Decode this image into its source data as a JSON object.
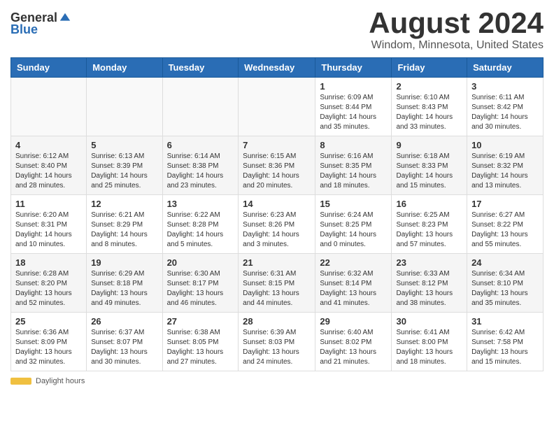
{
  "header": {
    "logo_general": "General",
    "logo_blue": "Blue",
    "title": "August 2024",
    "subtitle": "Windom, Minnesota, United States"
  },
  "days_of_week": [
    "Sunday",
    "Monday",
    "Tuesday",
    "Wednesday",
    "Thursday",
    "Friday",
    "Saturday"
  ],
  "weeks": [
    [
      {
        "day": "",
        "info": ""
      },
      {
        "day": "",
        "info": ""
      },
      {
        "day": "",
        "info": ""
      },
      {
        "day": "",
        "info": ""
      },
      {
        "day": "1",
        "info": "Sunrise: 6:09 AM\nSunset: 8:44 PM\nDaylight: 14 hours and 35 minutes."
      },
      {
        "day": "2",
        "info": "Sunrise: 6:10 AM\nSunset: 8:43 PM\nDaylight: 14 hours and 33 minutes."
      },
      {
        "day": "3",
        "info": "Sunrise: 6:11 AM\nSunset: 8:42 PM\nDaylight: 14 hours and 30 minutes."
      }
    ],
    [
      {
        "day": "4",
        "info": "Sunrise: 6:12 AM\nSunset: 8:40 PM\nDaylight: 14 hours and 28 minutes."
      },
      {
        "day": "5",
        "info": "Sunrise: 6:13 AM\nSunset: 8:39 PM\nDaylight: 14 hours and 25 minutes."
      },
      {
        "day": "6",
        "info": "Sunrise: 6:14 AM\nSunset: 8:38 PM\nDaylight: 14 hours and 23 minutes."
      },
      {
        "day": "7",
        "info": "Sunrise: 6:15 AM\nSunset: 8:36 PM\nDaylight: 14 hours and 20 minutes."
      },
      {
        "day": "8",
        "info": "Sunrise: 6:16 AM\nSunset: 8:35 PM\nDaylight: 14 hours and 18 minutes."
      },
      {
        "day": "9",
        "info": "Sunrise: 6:18 AM\nSunset: 8:33 PM\nDaylight: 14 hours and 15 minutes."
      },
      {
        "day": "10",
        "info": "Sunrise: 6:19 AM\nSunset: 8:32 PM\nDaylight: 14 hours and 13 minutes."
      }
    ],
    [
      {
        "day": "11",
        "info": "Sunrise: 6:20 AM\nSunset: 8:31 PM\nDaylight: 14 hours and 10 minutes."
      },
      {
        "day": "12",
        "info": "Sunrise: 6:21 AM\nSunset: 8:29 PM\nDaylight: 14 hours and 8 minutes."
      },
      {
        "day": "13",
        "info": "Sunrise: 6:22 AM\nSunset: 8:28 PM\nDaylight: 14 hours and 5 minutes."
      },
      {
        "day": "14",
        "info": "Sunrise: 6:23 AM\nSunset: 8:26 PM\nDaylight: 14 hours and 3 minutes."
      },
      {
        "day": "15",
        "info": "Sunrise: 6:24 AM\nSunset: 8:25 PM\nDaylight: 14 hours and 0 minutes."
      },
      {
        "day": "16",
        "info": "Sunrise: 6:25 AM\nSunset: 8:23 PM\nDaylight: 13 hours and 57 minutes."
      },
      {
        "day": "17",
        "info": "Sunrise: 6:27 AM\nSunset: 8:22 PM\nDaylight: 13 hours and 55 minutes."
      }
    ],
    [
      {
        "day": "18",
        "info": "Sunrise: 6:28 AM\nSunset: 8:20 PM\nDaylight: 13 hours and 52 minutes."
      },
      {
        "day": "19",
        "info": "Sunrise: 6:29 AM\nSunset: 8:18 PM\nDaylight: 13 hours and 49 minutes."
      },
      {
        "day": "20",
        "info": "Sunrise: 6:30 AM\nSunset: 8:17 PM\nDaylight: 13 hours and 46 minutes."
      },
      {
        "day": "21",
        "info": "Sunrise: 6:31 AM\nSunset: 8:15 PM\nDaylight: 13 hours and 44 minutes."
      },
      {
        "day": "22",
        "info": "Sunrise: 6:32 AM\nSunset: 8:14 PM\nDaylight: 13 hours and 41 minutes."
      },
      {
        "day": "23",
        "info": "Sunrise: 6:33 AM\nSunset: 8:12 PM\nDaylight: 13 hours and 38 minutes."
      },
      {
        "day": "24",
        "info": "Sunrise: 6:34 AM\nSunset: 8:10 PM\nDaylight: 13 hours and 35 minutes."
      }
    ],
    [
      {
        "day": "25",
        "info": "Sunrise: 6:36 AM\nSunset: 8:09 PM\nDaylight: 13 hours and 32 minutes."
      },
      {
        "day": "26",
        "info": "Sunrise: 6:37 AM\nSunset: 8:07 PM\nDaylight: 13 hours and 30 minutes."
      },
      {
        "day": "27",
        "info": "Sunrise: 6:38 AM\nSunset: 8:05 PM\nDaylight: 13 hours and 27 minutes."
      },
      {
        "day": "28",
        "info": "Sunrise: 6:39 AM\nSunset: 8:03 PM\nDaylight: 13 hours and 24 minutes."
      },
      {
        "day": "29",
        "info": "Sunrise: 6:40 AM\nSunset: 8:02 PM\nDaylight: 13 hours and 21 minutes."
      },
      {
        "day": "30",
        "info": "Sunrise: 6:41 AM\nSunset: 8:00 PM\nDaylight: 13 hours and 18 minutes."
      },
      {
        "day": "31",
        "info": "Sunrise: 6:42 AM\nSunset: 7:58 PM\nDaylight: 13 hours and 15 minutes."
      }
    ]
  ],
  "footer": {
    "daylight_label": "Daylight hours"
  }
}
